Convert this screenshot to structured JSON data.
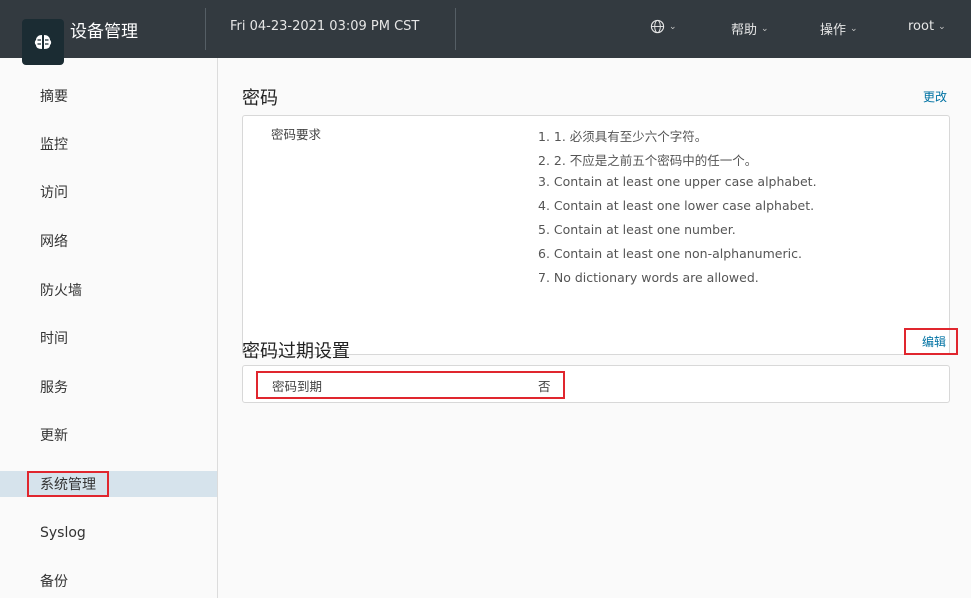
{
  "header": {
    "title": "设备管理",
    "datetime": "Fri 04-23-2021 03:09 PM CST",
    "menu_help": "帮助",
    "menu_actions": "操作",
    "menu_user": "root"
  },
  "sidebar": {
    "items": [
      "摘要",
      "监控",
      "访问",
      "网络",
      "防火墙",
      "时间",
      "服务",
      "更新",
      "系统管理",
      "Syslog",
      "备份"
    ],
    "active": "系统管理"
  },
  "password": {
    "title": "密码",
    "change_link": "更改",
    "req_label": "密码要求",
    "requirements": [
      "1. 1. 必须具有至少六个字符。",
      "2. 2. 不应是之前五个密码中的任一个。",
      "3. Contain at least one upper case alphabet.",
      "4. Contain at least one lower case alphabet.",
      "5. Contain at least one number.",
      "6. Contain at least one non-alphanumeric.",
      "7. No dictionary words are allowed."
    ]
  },
  "expiry": {
    "title": "密码过期设置",
    "edit_link": "编辑",
    "label": "密码到期",
    "value": "否"
  },
  "colors": {
    "header_bg": "#333a40",
    "accent_link": "#0072a3",
    "highlight": "#e0262e",
    "active_row": "#d6e3ec"
  }
}
